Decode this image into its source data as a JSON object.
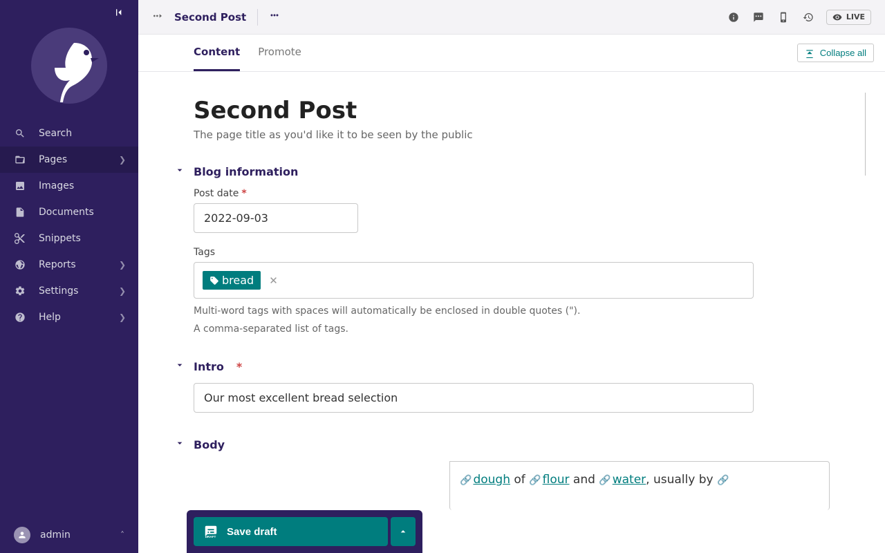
{
  "sidebar": {
    "search_label": "Search",
    "items": [
      {
        "label": "Pages",
        "has_children": true,
        "active": true
      },
      {
        "label": "Images"
      },
      {
        "label": "Documents"
      },
      {
        "label": "Snippets"
      },
      {
        "label": "Reports",
        "has_children": true
      },
      {
        "label": "Settings",
        "has_children": true
      },
      {
        "label": "Help",
        "has_children": true
      }
    ],
    "user": "admin"
  },
  "header": {
    "title": "Second Post",
    "live_badge": "LIVE"
  },
  "tabs": {
    "content": "Content",
    "promote": "Promote",
    "collapse_all": "Collapse all"
  },
  "page": {
    "title": "Second Post",
    "title_help": "The page title as you'd like it to be seen by the public"
  },
  "sections": {
    "blog_info": {
      "heading": "Blog information",
      "post_date_label": "Post date",
      "post_date_value": "2022-09-03",
      "tags_label": "Tags",
      "tags": [
        "bread"
      ],
      "tags_help1": "Multi-word tags with spaces will automatically be enclosed in double quotes (\").",
      "tags_help2": "A comma-separated list of tags."
    },
    "intro": {
      "heading": "Intro",
      "value": "Our most excellent bread selection"
    },
    "body": {
      "heading": "Body",
      "link1": "dough",
      "mid1": " of ",
      "link2": "flour",
      "mid2": " and ",
      "link3": "water",
      "tail": ", usually by "
    }
  },
  "actions": {
    "save_draft": "Save draft"
  }
}
